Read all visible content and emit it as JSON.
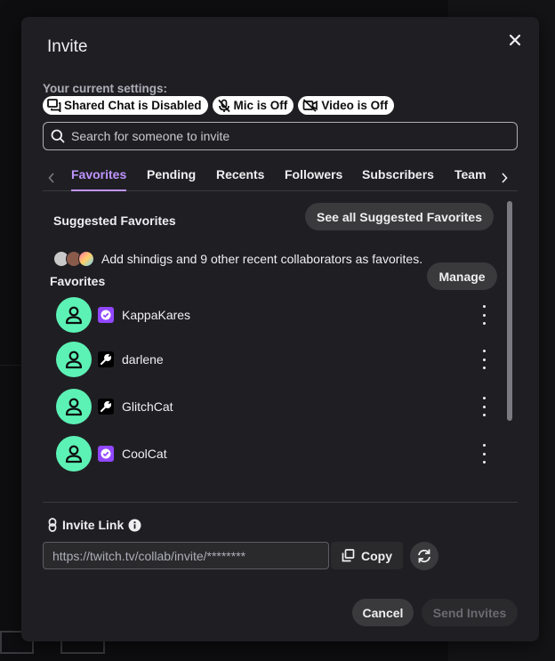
{
  "modal": {
    "title": "Invite"
  },
  "settings": {
    "label": "Your current settings:",
    "pills": [
      {
        "icon": "shared-chat-icon",
        "label": "Shared Chat is Disabled"
      },
      {
        "icon": "mic-off-icon",
        "label": "Mic is Off"
      },
      {
        "icon": "video-off-icon",
        "label": "Video is Off"
      }
    ]
  },
  "search": {
    "placeholder": "Search for someone to invite"
  },
  "tabs": [
    "Favorites",
    "Pending",
    "Recents",
    "Followers",
    "Subscribers",
    "Team"
  ],
  "active_tab": "Favorites",
  "suggested": {
    "title": "Suggested Favorites",
    "see_all_label": "See all Suggested Favorites",
    "text": "Add shindigs and 9 other recent collaborators as favorites."
  },
  "favorites": {
    "title": "Favorites",
    "manage_label": "Manage",
    "items": [
      {
        "name": "KappaKares",
        "badge": "verified-icon"
      },
      {
        "name": "darlene",
        "badge": "wrench-icon"
      },
      {
        "name": "GlitchCat",
        "badge": "wrench-icon"
      },
      {
        "name": "CoolCat",
        "badge": "verified-icon"
      }
    ]
  },
  "invite_link": {
    "label": "Invite Link",
    "url": "https://twitch.tv/collab/invite/********",
    "copy_label": "Copy"
  },
  "footer": {
    "cancel_label": "Cancel",
    "send_label": "Send Invites"
  },
  "colors": {
    "accent": "#bf94ff",
    "avatar": "#5cf2b5",
    "verified": "#9147ff",
    "modal_bg": "#1f1f23"
  }
}
